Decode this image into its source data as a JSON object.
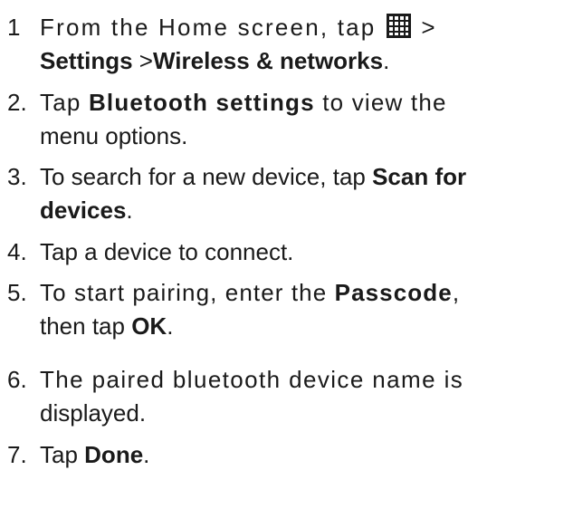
{
  "steps": [
    {
      "number": "1",
      "line1_a": "From the Home screen, tap",
      "icon": "apps-grid-icon",
      "line1_b": ">",
      "line2_settings": "Settings",
      "line2_sep": " >",
      "line2_wireless": "Wireless & networks",
      "line2_end": "."
    },
    {
      "number": "2.",
      "line1_a": "Tap ",
      "line1_bold": "Bluetooth settings",
      "line1_b": " to view the",
      "line2": "menu options."
    },
    {
      "number": "3.",
      "line1_a": "To search for a new device, tap ",
      "line1_bold": "Scan for",
      "line2_bold": "devices",
      "line2_end": "."
    },
    {
      "number": "4.",
      "line1": "Tap a device to connect."
    },
    {
      "number": "5.",
      "line1_a": "To start pairing, enter the ",
      "line1_bold": "Passcode",
      "line1_b": ",",
      "line2_a": "then tap ",
      "line2_bold": "OK",
      "line2_end": "."
    },
    {
      "number": "6.",
      "line1": "The paired bluetooth device name is",
      "line2": "displayed."
    },
    {
      "number": "7.",
      "line1_a": "Tap ",
      "line1_bold": "Done",
      "line1_end": "."
    }
  ]
}
